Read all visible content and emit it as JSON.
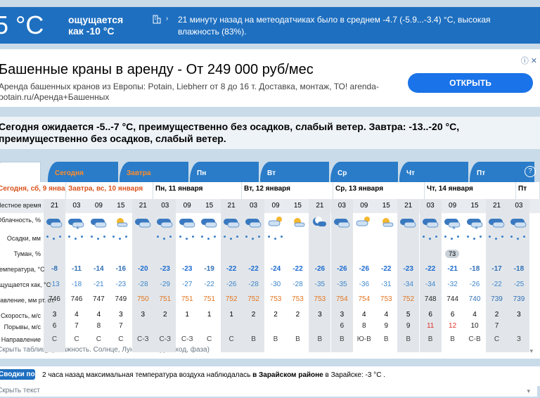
{
  "current": {
    "temp": "5 °C",
    "feels_like": "ощущается как -10 °C",
    "note": "21 минуту назад на метеодатчиках было в среднем -4.7 (-5.9...-3.4) °C, высокая влажность (83%)."
  },
  "ad": {
    "title": "Башенные краны в аренду - От 249 000 руб/мес",
    "text": "Аренда башенных кранов из Европы: Potain, Liebherr от 8 до 16 т. Доставка, монтаж, ТО! arenda-potain.ru/Аренда+Башенных",
    "button": "ОТКРЫТЬ",
    "badges": "ⓘ ✕"
  },
  "summary": "Сегодня ожидается -5..-7 °C, преимущественно без осадков, слабый ветер. Завтра: -13..-20 °C, преимущественно без осадков, слабый ветер.",
  "tabs": [
    {
      "label": "",
      "first": true
    },
    {
      "label": "Сегодня",
      "hl": true
    },
    {
      "label": "Завтра",
      "hl": true
    },
    {
      "label": "Пн"
    },
    {
      "label": "Вт"
    },
    {
      "label": "Ср"
    },
    {
      "label": "Чт"
    },
    {
      "label": "Пт"
    }
  ],
  "help": "?",
  "days": [
    {
      "label": "Сегодня, сб, 9 января",
      "today": true
    },
    {
      "label": "Завтра, вс, 10 января",
      "today": true
    },
    {
      "label": "Пн, 11 января"
    },
    {
      "label": "Вт, 12 января"
    },
    {
      "label": "Ср, 13 января"
    },
    {
      "label": "Чт, 14 января"
    },
    {
      "label": "Пт"
    }
  ],
  "row_labels": {
    "time": "Местное время",
    "cloud": "Облачность, %",
    "precip": "Осадки, мм",
    "fog": "Туман, %",
    "temp": "Температура, °С",
    "feels": "ощущается как, °С",
    "pressure": "Давление, мм рт. ст.",
    "wind": "Скорость, м/с",
    "gusts": "Порывы, м/с",
    "direction": "Направление"
  },
  "times": [
    "21",
    "03",
    "09",
    "15",
    "21",
    "03",
    "09",
    "15",
    "21",
    "03",
    "09",
    "15",
    "21",
    "03",
    "09",
    "15",
    "21",
    "03",
    "09",
    "15",
    "21",
    "03"
  ],
  "temps": [
    "-8",
    "-11",
    "-14",
    "-16",
    "-20",
    "-23",
    "-23",
    "-19",
    "-22",
    "-22",
    "-24",
    "-22",
    "-26",
    "-26",
    "-26",
    "-22",
    "-23",
    "-22",
    "-21",
    "-18",
    "-17",
    "-18"
  ],
  "feels": [
    "-13",
    "-18",
    "-21",
    "-23",
    "-28",
    "-29",
    "-27",
    "-22",
    "-26",
    "-28",
    "-30",
    "-28",
    "-35",
    "-35",
    "-36",
    "-31",
    "-34",
    "-34",
    "-32",
    "-26",
    "-22",
    "-25"
  ],
  "pressure": [
    "746",
    "746",
    "747",
    "749",
    "750",
    "751",
    "751",
    "751",
    "752",
    "752",
    "753",
    "753",
    "753",
    "754",
    "754",
    "753",
    "752",
    "748",
    "744",
    "740",
    "739",
    "739"
  ],
  "wind": [
    "3",
    "4",
    "4",
    "3",
    "3",
    "2",
    "1",
    "1",
    "1",
    "2",
    "2",
    "2",
    "3",
    "3",
    "4",
    "4",
    "5",
    "6",
    "6",
    "4",
    "2",
    "3"
  ],
  "gusts": [
    "6",
    "7",
    "8",
    "7",
    "",
    "",
    "",
    "",
    "",
    "",
    "",
    "",
    "",
    "6",
    "8",
    "9",
    "9",
    "11",
    "12",
    "10",
    "7",
    ""
  ],
  "direction": [
    "С",
    "С",
    "С",
    "С",
    "С-З",
    "С-З",
    "С-З",
    "С",
    "С",
    "В",
    "В",
    "В",
    "В",
    "В",
    "Ю-В",
    "В",
    "В",
    "В",
    "В",
    "С-В",
    "С",
    "З"
  ],
  "fog_value": "73",
  "colors": {
    "accent": "#1e6fc0",
    "today": "#d9521b",
    "temp_blue": "#2f6fb6",
    "feels_blue": "#3d86cc",
    "pressure_orange": "#e3741e",
    "gust_red": "#e0302a",
    "cold_blue": "#1c6bd1"
  },
  "bottom_link": "Скрыть таблицу (Влажность. Солнце, Луна: восход, заход, фаза)",
  "observations": {
    "button": "Сводки погоды",
    "text": "2 часа назад максимальная температура воздуха наблюдалась",
    "bold": "в Зарайском районе",
    "tail": "в Зарайске: -3 °С ."
  },
  "more": "Скрыть текст"
}
